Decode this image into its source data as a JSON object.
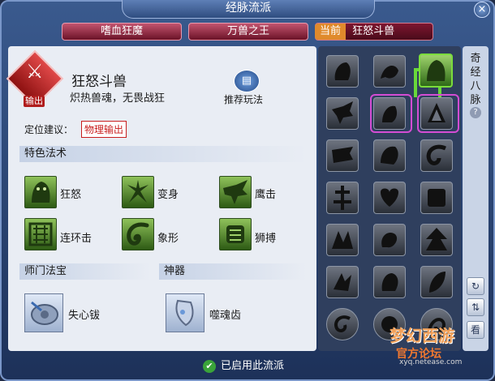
{
  "window": {
    "title": "经脉流派",
    "close_label": "×"
  },
  "tabs": [
    {
      "label": "嗜血狂魔"
    },
    {
      "label": "万兽之王"
    },
    {
      "prefix": "当前",
      "label": "狂怒斗兽"
    }
  ],
  "school": {
    "name": "狂怒斗兽",
    "motto": "炽热兽魂，无畏战狂",
    "role_badge": "输出",
    "recommend_label": "推荐玩法",
    "position_label": "定位建议：",
    "position_value": "物理输出"
  },
  "sections": {
    "skills": "特色法术",
    "treasure": "师门法宝",
    "artifact": "神器"
  },
  "skills": [
    {
      "name": "狂怒",
      "icon": "beast-rage-icon"
    },
    {
      "name": "变身",
      "icon": "transform-icon"
    },
    {
      "name": "鹰击",
      "icon": "eagle-strike-icon"
    },
    {
      "name": "连环击",
      "icon": "combo-strike-icon"
    },
    {
      "name": "象形",
      "icon": "elephant-form-icon"
    },
    {
      "name": "狮搏",
      "icon": "lion-fight-icon"
    }
  ],
  "treasure": {
    "name": "失心钹",
    "icon": "cymbal-icon"
  },
  "artifact": {
    "name": "噬魂齿",
    "icon": "soul-tooth-icon"
  },
  "side": {
    "label_chars": [
      "奇",
      "经",
      "八",
      "脉"
    ],
    "help": "?",
    "buttons": [
      "↻",
      "⇅",
      "看"
    ]
  },
  "footer": {
    "status": "已启用此流派"
  },
  "watermark": {
    "text": "官方论坛",
    "url": "xyq.netease.com"
  }
}
